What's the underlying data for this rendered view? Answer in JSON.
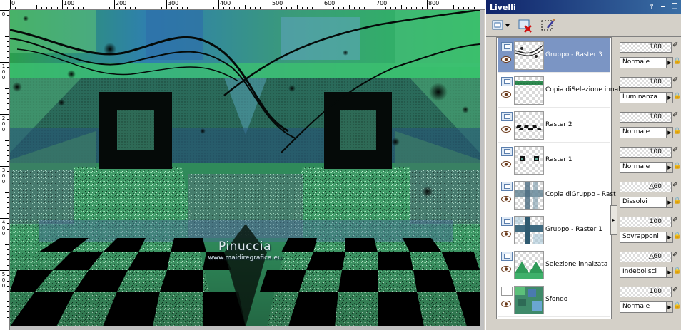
{
  "ruler": {
    "h_labels": [
      "0",
      "100",
      "200",
      "300",
      "400",
      "500",
      "600",
      "700",
      "800"
    ],
    "v_labels": [
      "0",
      "100",
      "200",
      "300",
      "400",
      "500"
    ]
  },
  "canvas": {
    "watermark_title": "Pinuccia",
    "watermark_url": "www.maidiregrafica.eu"
  },
  "panel": {
    "title": "Livelli",
    "pin_icon": "pin-icon",
    "minimize_icon": "minimize-icon",
    "restore_icon": "restore-icon",
    "close_icon": "close-icon",
    "toolbar": [
      "new-layer-icon",
      "delete-layer-icon",
      "edit-selection-icon"
    ]
  },
  "layers": [
    {
      "name": "Gruppo - Raster 3",
      "type": "group",
      "selected": true,
      "opacity": "100",
      "blend": "Normale"
    },
    {
      "name": "Copia diSelezione innal",
      "type": "raster",
      "selected": false,
      "opacity": "100",
      "blend": "Luminanza"
    },
    {
      "name": "Raster 2",
      "type": "raster",
      "selected": false,
      "opacity": "100",
      "blend": "Normale"
    },
    {
      "name": "Raster 1",
      "type": "raster",
      "selected": false,
      "opacity": "100",
      "blend": "Normale"
    },
    {
      "name": "Copia diGruppo - Rast",
      "type": "group",
      "selected": false,
      "opacity": "60",
      "blend": "Dissolvi"
    },
    {
      "name": "Gruppo - Raster 1",
      "type": "group",
      "selected": false,
      "opacity": "100",
      "blend": "Sovrapponi"
    },
    {
      "name": "Selezione innalzata",
      "type": "raster",
      "selected": false,
      "opacity": "60",
      "blend": "Indebolisci"
    },
    {
      "name": "Sfondo",
      "type": "background",
      "selected": false,
      "opacity": "100",
      "blend": "Normale"
    }
  ],
  "colors": {
    "selected_row": "#7b95c4",
    "title_bar": "#10246a",
    "canvas_green": "#3fa86a",
    "canvas_dark": "#06120c"
  }
}
